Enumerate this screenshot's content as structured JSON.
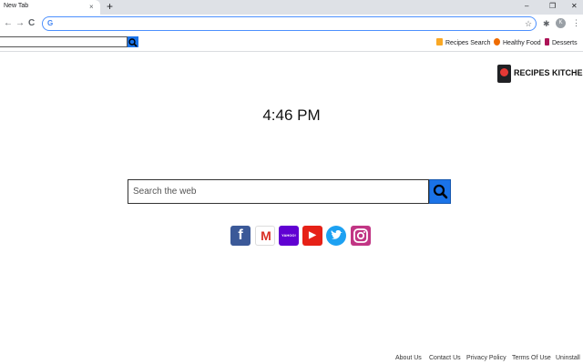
{
  "browser": {
    "tab_title": "New Tab",
    "tab_close": "×",
    "new_tab": "+",
    "window_controls": [
      "–",
      "❐",
      "✕"
    ],
    "nav": {
      "back": "←",
      "forward": "→",
      "reload": "C"
    },
    "omnibox_icon": "G",
    "omnibox_value": "",
    "star": "☆",
    "extension_icon": "✱",
    "avatar_letter": "K",
    "menu": "⋮"
  },
  "bookmarks_bar": {
    "items": [
      {
        "label": "Recipes Search",
        "icon": "recipes-icon",
        "color": "#f9a825"
      },
      {
        "label": "Healthy Food",
        "icon": "healthy-food-icon",
        "color": "#ef6c00"
      },
      {
        "label": "Desserts",
        "icon": "desserts-icon",
        "color": "#ad1457"
      }
    ]
  },
  "brand": {
    "name": "RECIPES KITCHEN"
  },
  "clock": "4:46 PM",
  "search": {
    "placeholder": "Search the web",
    "value": "",
    "button_color": "#1a73e8"
  },
  "social": [
    {
      "name": "facebook",
      "glyph": "f"
    },
    {
      "name": "gmail",
      "glyph": "M"
    },
    {
      "name": "yahoo",
      "glyph": "YAHOO!"
    },
    {
      "name": "youtube",
      "glyph": "▶"
    },
    {
      "name": "twitter",
      "glyph": "🐦"
    },
    {
      "name": "instagram",
      "glyph": "◎"
    }
  ],
  "footer": {
    "links": [
      "About Us",
      "Contact Us",
      "Privacy Policy",
      "Terms Of Use",
      "Uninstall"
    ]
  },
  "colors": {
    "accent": "#1a73e8",
    "tabbar": "#dee1e6"
  }
}
